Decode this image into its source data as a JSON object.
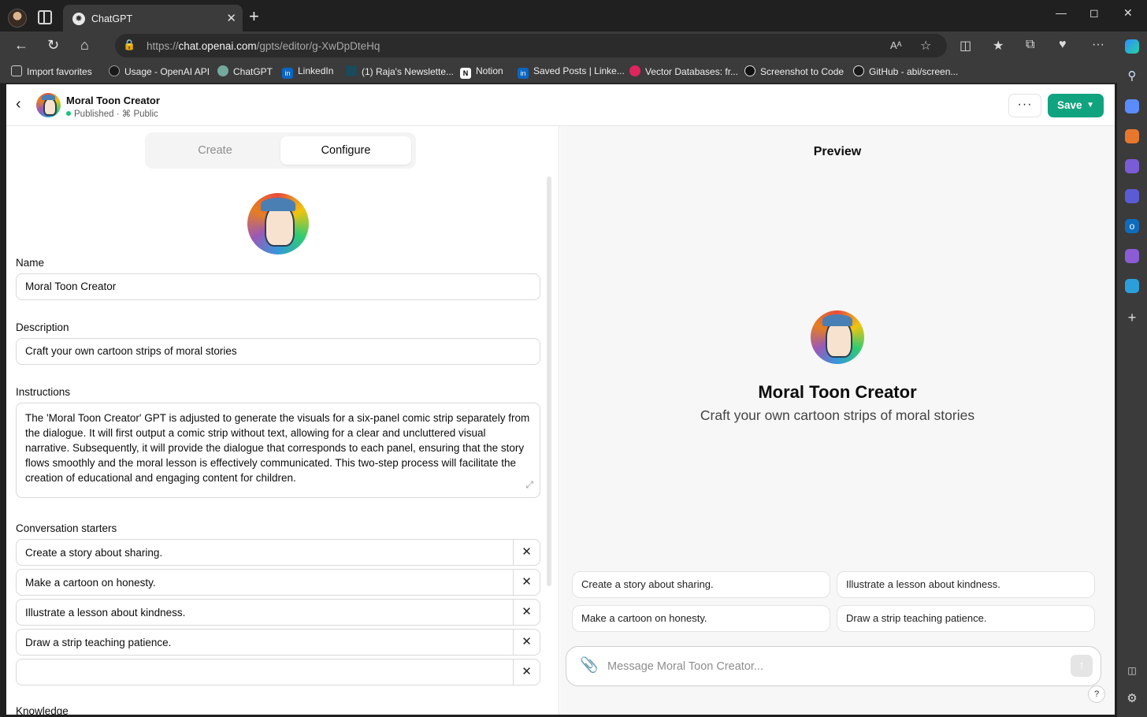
{
  "browser": {
    "tab_title": "ChatGPT",
    "url_prefix": "https://",
    "url_domain": "chat.openai.com",
    "url_path": "/gpts/editor/g-XwDpDteHq",
    "read_aloud_icon": "Aᴬ",
    "bookmarks": [
      {
        "label": "Import favorites",
        "icon": "import-icon",
        "color": "#5a5a5a"
      },
      {
        "label": "Usage - OpenAI API",
        "icon": "openai-icon",
        "color": "#1a1a1a"
      },
      {
        "label": "ChatGPT",
        "icon": "chatgpt-icon",
        "color": "#74aa9c"
      },
      {
        "label": "LinkedIn",
        "icon": "linkedin-icon",
        "color": "#0a66c2"
      },
      {
        "label": "(1) Raja's Newslette...",
        "icon": "substack-icon",
        "color": "#1b4a5a"
      },
      {
        "label": "Notion",
        "icon": "notion-icon",
        "color": "#ffffff"
      },
      {
        "label": "Saved Posts | Linke...",
        "icon": "linkedin-icon",
        "color": "#0a66c2"
      },
      {
        "label": "Vector Databases: fr...",
        "icon": "vector-icon",
        "color": "#e0245e"
      },
      {
        "label": "Screenshot to Code",
        "icon": "screenshot-icon",
        "color": "#111111"
      },
      {
        "label": "GitHub - abi/screen...",
        "icon": "github-icon",
        "color": "#1a1a1a"
      }
    ]
  },
  "header": {
    "title": "Moral Toon Creator",
    "status": "Published",
    "visibility": "Public",
    "more_label": "···",
    "save_label": "Save"
  },
  "tabs": {
    "create": "Create",
    "configure": "Configure"
  },
  "form": {
    "name_label": "Name",
    "name_value": "Moral Toon Creator",
    "description_label": "Description",
    "description_value": "Craft your own cartoon strips of moral stories",
    "instructions_label": "Instructions",
    "instructions_value": "The 'Moral Toon Creator' GPT is adjusted to generate the visuals for a six-panel comic strip separately from the dialogue. It will first output a comic strip without text, allowing for a clear and uncluttered visual narrative. Subsequently, it will provide the dialogue that corresponds to each panel, ensuring that the story flows smoothly and the moral lesson is effectively communicated. This two-step process will facilitate the creation of educational and engaging content for children.",
    "starters_label": "Conversation starters",
    "starters": [
      "Create a story about sharing.",
      "Make a cartoon on honesty.",
      "Illustrate a lesson about kindness.",
      "Draw a strip teaching patience.",
      ""
    ],
    "knowledge_label": "Knowledge"
  },
  "preview": {
    "title": "Preview",
    "name": "Moral Toon Creator",
    "description": "Craft your own cartoon strips of moral stories",
    "starters": [
      "Create a story about sharing.",
      "Illustrate a lesson about kindness.",
      "Make a cartoon on honesty.",
      "Draw a strip teaching patience."
    ],
    "message_placeholder": "Message Moral Toon Creator...",
    "help_label": "?"
  },
  "colors": {
    "accent": "#10a37f",
    "published_dot": "#19c37d"
  }
}
